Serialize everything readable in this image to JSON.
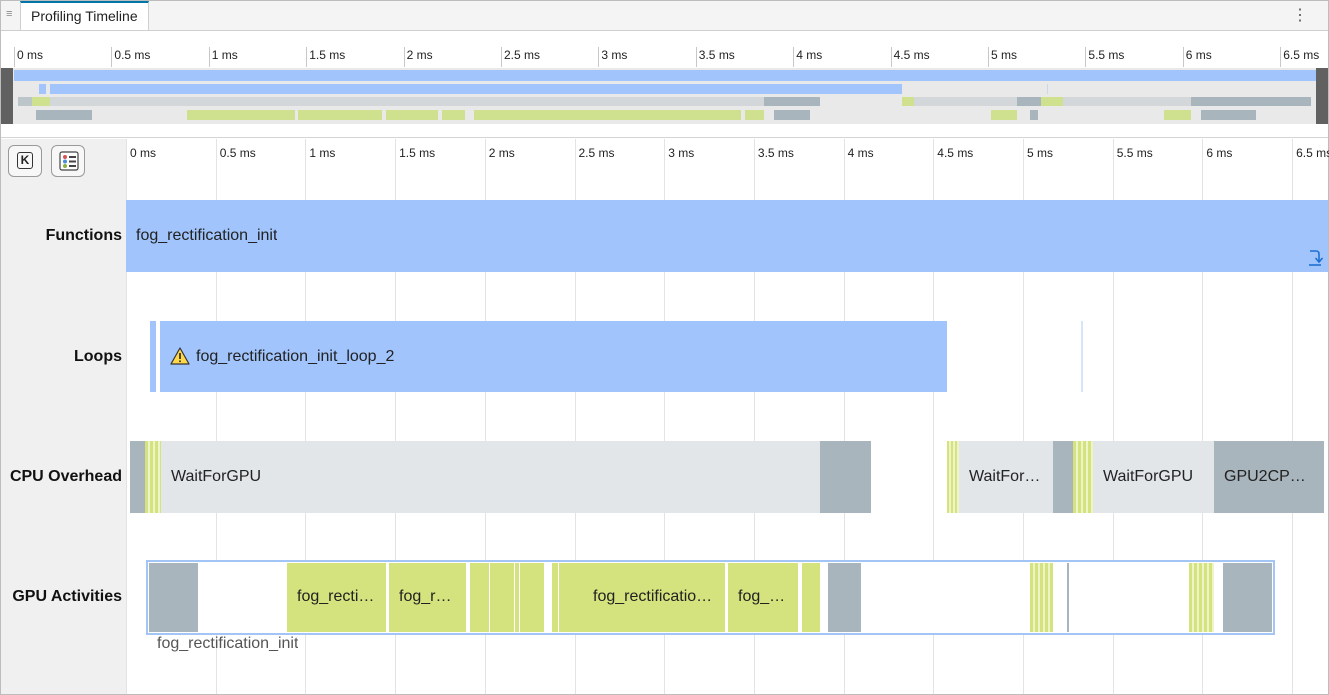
{
  "window": {
    "tab_title": "Profiling Timeline",
    "grip_icon": "grip-icon",
    "menu_icon": "kebab-menu-icon",
    "menu_glyph": "⋮",
    "grip_glyph": "≡"
  },
  "overview": {
    "ticks": [
      "0 ms",
      "0.5 ms",
      "1 ms",
      "1.5 ms",
      "2 ms",
      "2.5 ms",
      "3 ms",
      "3.5 ms",
      "4 ms",
      "4.5 ms",
      "5 ms",
      "5.5 ms",
      "6 ms",
      "6.5 ms"
    ]
  },
  "toolbar": {
    "keyboard_icon": "keyboard-shortcuts-icon",
    "keyboard_glyph": "K",
    "legend_icon": "legend-icon"
  },
  "timeline": {
    "ticks": [
      "0 ms",
      "0.5 ms",
      "1 ms",
      "1.5 ms",
      "2 ms",
      "2.5 ms",
      "3 ms",
      "3.5 ms",
      "4 ms",
      "4.5 ms",
      "5 ms",
      "5.5 ms",
      "6 ms",
      "6.5 ms"
    ],
    "rows": {
      "functions": "Functions",
      "loops": "Loops",
      "cpu": "CPU Overhead",
      "gpu": "GPU Activities"
    },
    "functions_bar": "fog_rectification_init",
    "step_into_icon": "step-into-icon",
    "loops_bar": "fog_rectification_init_loop_2",
    "loops_warning_icon": "warning-icon",
    "cpu_bars": [
      "WaitForGPU",
      "WaitFor…",
      "WaitForGPU",
      "GPU2CP…"
    ],
    "gpu_bars": [
      "fog_recti…",
      "fog_r…",
      "fog_rectificatio…",
      "fog_…"
    ],
    "gpu_group_label": "fog_rectification_init"
  },
  "colors": {
    "function_blue": "#a0c4fb",
    "cpu_light": "#e2e6e9",
    "cpu_dark": "#a8b5bc",
    "gpu_green": "#d4e37d",
    "selection": "#a3c5f6"
  }
}
